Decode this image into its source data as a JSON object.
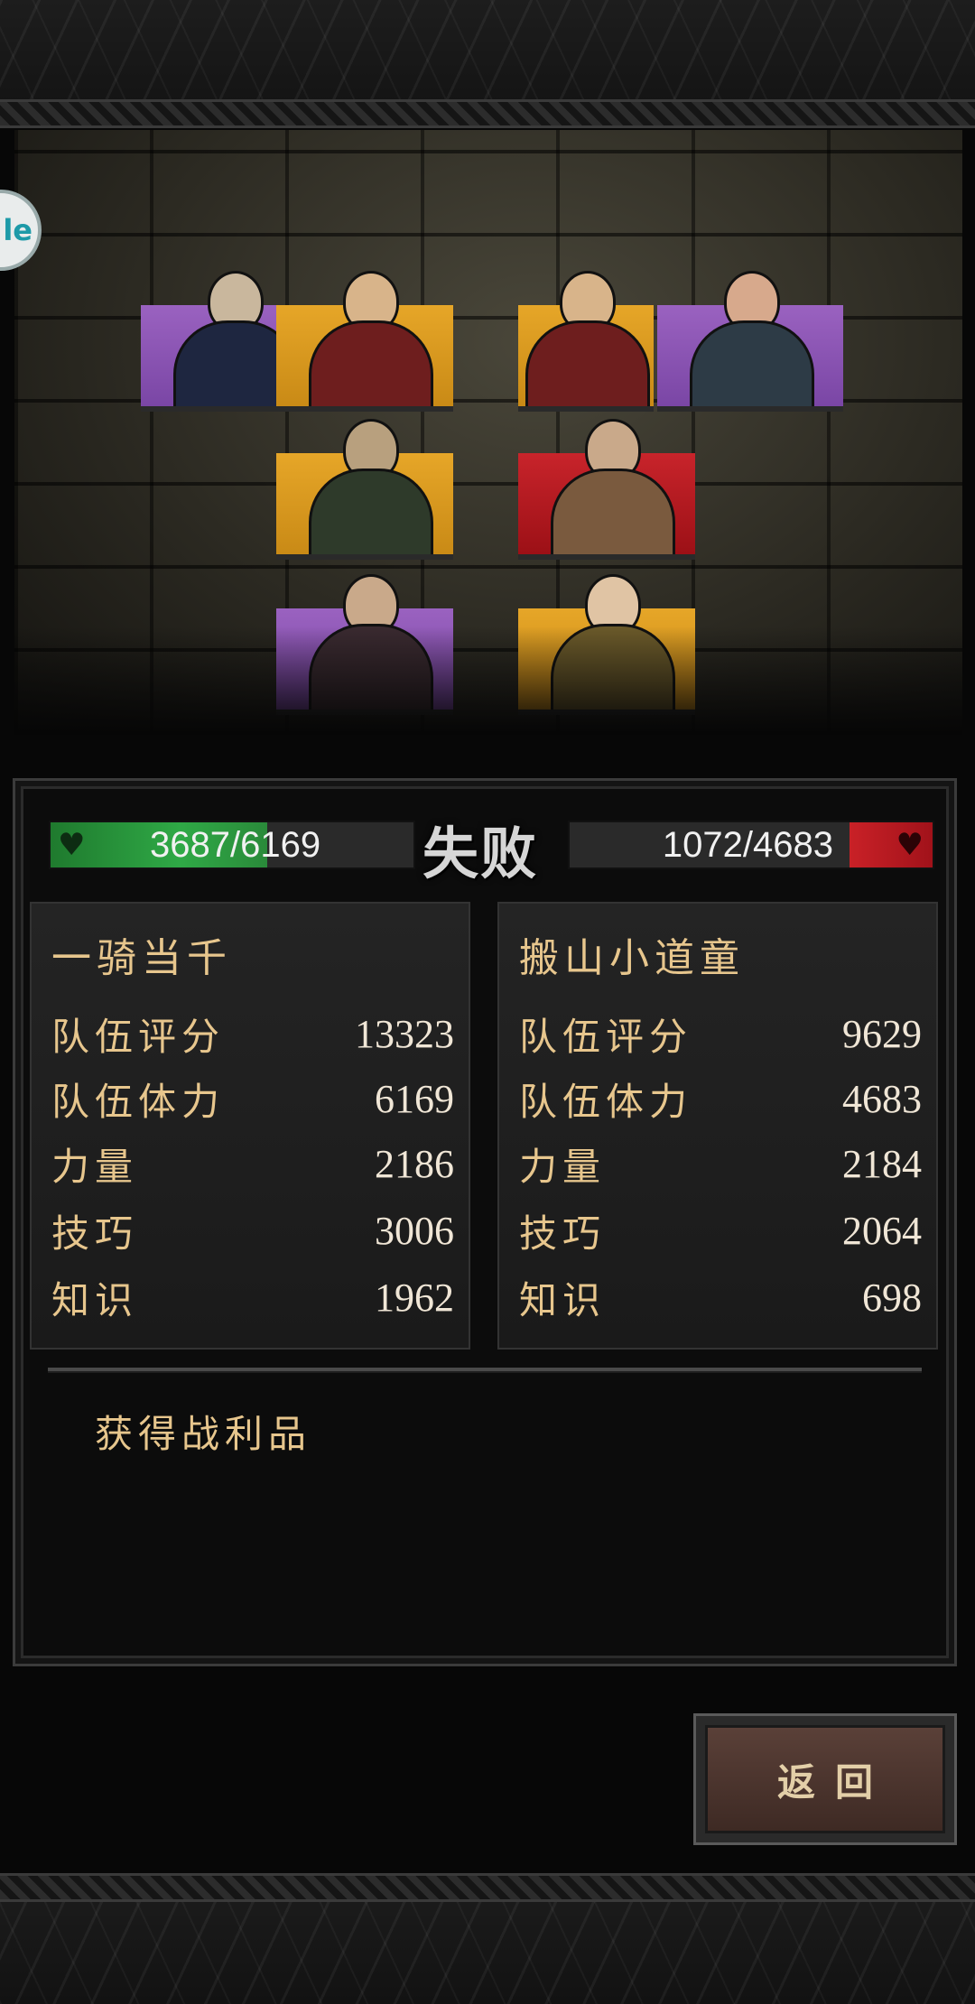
{
  "side_badge": {
    "text": "le"
  },
  "battle": {
    "result_title": "失败",
    "player": {
      "hp_text": "3687/6169",
      "hp_fraction": 0.598,
      "team_name": "一骑当千",
      "stats": [
        {
          "label": "队伍评分",
          "value": "13323"
        },
        {
          "label": "队伍体力",
          "value": "6169"
        },
        {
          "label": "力量",
          "value": "2186"
        },
        {
          "label": "技巧",
          "value": "3006"
        },
        {
          "label": "知识",
          "value": "1962"
        }
      ]
    },
    "enemy": {
      "hp_text": "1072/4683",
      "hp_fraction": 0.229,
      "team_name": "搬山小道童",
      "stats": [
        {
          "label": "队伍评分",
          "value": "9629"
        },
        {
          "label": "队伍体力",
          "value": "4683"
        },
        {
          "label": "力量",
          "value": "2184"
        },
        {
          "label": "技巧",
          "value": "2064"
        },
        {
          "label": "知识",
          "value": "698"
        }
      ]
    }
  },
  "loot": {
    "title": "获得战利品"
  },
  "return_button": {
    "label": "返回"
  },
  "portraits": [
    {
      "side": "player",
      "rarity_color": "#8a55b5",
      "body_color": "#1e2640"
    },
    {
      "side": "player",
      "rarity_color": "#d89a20",
      "body_color": "#6e1e1e"
    },
    {
      "side": "player",
      "rarity_color": "#d89a20",
      "body_color": "#2e3a2a"
    },
    {
      "side": "player",
      "rarity_color": "#8a55b5",
      "body_color": "#3a2a30"
    },
    {
      "side": "enemy",
      "rarity_color": "#d89a20",
      "body_color": "#6e1e1e"
    },
    {
      "side": "enemy",
      "rarity_color": "#8a55b5",
      "body_color": "#2d3b46"
    },
    {
      "side": "enemy",
      "rarity_color": "#c8242b",
      "body_color": "#7a5a3e"
    },
    {
      "side": "enemy",
      "rarity_color": "#d89a20",
      "body_color": "#6b5a2a"
    }
  ],
  "colors": {
    "accent_text": "#e7c68d",
    "player_hp": "#2fa946",
    "enemy_hp": "#c92127"
  }
}
